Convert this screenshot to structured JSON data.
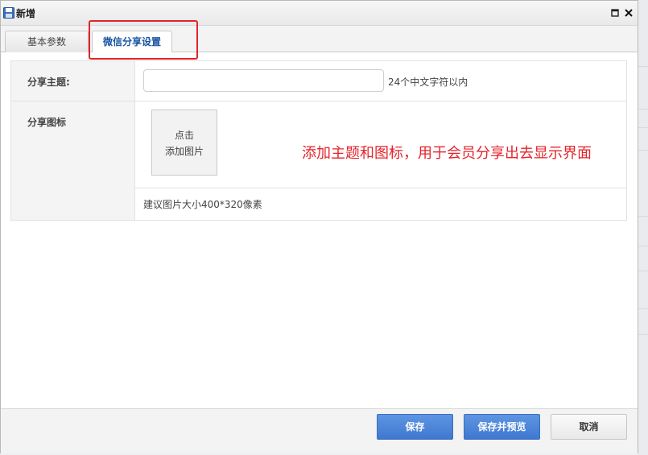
{
  "window": {
    "title": "新增",
    "icon": "save-disk-icon"
  },
  "tabs": [
    {
      "label": "基本参数",
      "active": false
    },
    {
      "label": "微信分享设置",
      "active": true
    }
  ],
  "form": {
    "share_title": {
      "label": "分享主题:",
      "value": "",
      "placeholder": "",
      "hint": "24个中文字符以内"
    },
    "share_icon": {
      "label": "分享图标",
      "upload_line1": "点击",
      "upload_line2": "添加图片",
      "size_note": "建议图片大小400*320像素"
    }
  },
  "annotation": {
    "text": "添加主题和图标，用于会员分享出去显示界面",
    "color": "#e3242b"
  },
  "footer": {
    "save_label": "保存",
    "save_preview_label": "保存并预览",
    "cancel_label": "取消"
  },
  "colors": {
    "primary_button": "#3f78cf",
    "active_tab_text": "#1b55a3",
    "highlight": "#e3242b"
  }
}
